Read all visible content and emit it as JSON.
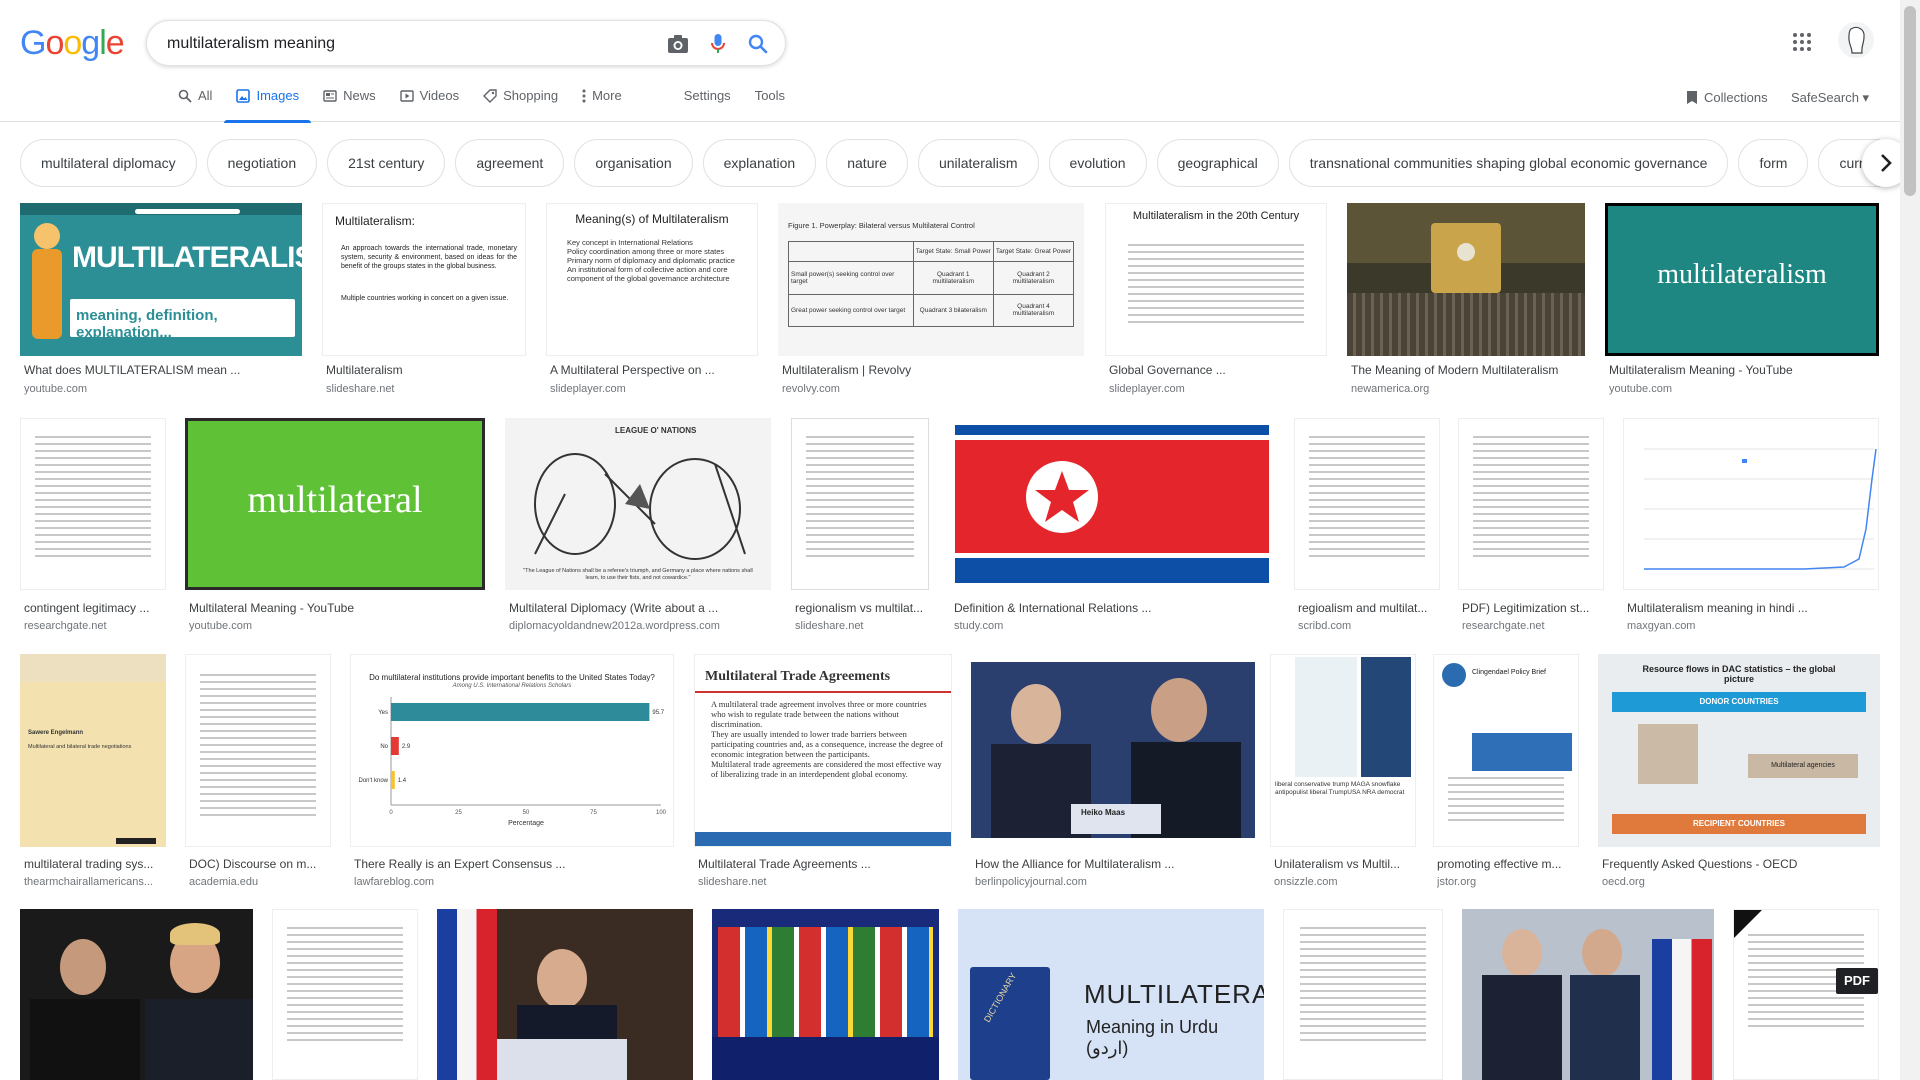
{
  "search": {
    "query": "multilateralism meaning"
  },
  "logo": {
    "letters": [
      "G",
      "o",
      "o",
      "g",
      "l",
      "e"
    ],
    "colors": [
      "#4285f4",
      "#ea4335",
      "#fbbc05",
      "#4285f4",
      "#34a853",
      "#ea4335"
    ]
  },
  "tabs": [
    {
      "label": "All",
      "icon": "search-icon"
    },
    {
      "label": "Images",
      "icon": "image-icon",
      "active": true
    },
    {
      "label": "News",
      "icon": "news-icon"
    },
    {
      "label": "Videos",
      "icon": "video-icon"
    },
    {
      "label": "Shopping",
      "icon": "tag-icon"
    },
    {
      "label": "More",
      "icon": "more-vert-icon"
    }
  ],
  "tools": {
    "settings": "Settings",
    "tools": "Tools"
  },
  "right_links": {
    "collections": "Collections",
    "safesearch": "SafeSearch ▾"
  },
  "chips": [
    "multilateral diplomacy",
    "negotiation",
    "21st century",
    "agreement",
    "organisation",
    "explanation",
    "nature",
    "unilateralism",
    "evolution",
    "geographical",
    "transnational communities shaping global economic governance",
    "form",
    "current"
  ],
  "results": [
    {
      "title": "What does MULTILATERALISM mean ...",
      "source": "youtube.com"
    },
    {
      "title": "Multilateralism",
      "source": "slideshare.net"
    },
    {
      "title": "A Multilateral Perspective on ...",
      "source": "slideplayer.com"
    },
    {
      "title": "Multilateralism | Revolvy",
      "source": "revolvy.com"
    },
    {
      "title": "Global Governance ...",
      "source": "slideplayer.com"
    },
    {
      "title": "The Meaning of Modern Multilateralism",
      "source": "newamerica.org"
    },
    {
      "title": "Multilateralism Meaning - YouTube",
      "source": "youtube.com"
    },
    {
      "title": "contingent legitimacy ...",
      "source": "researchgate.net"
    },
    {
      "title": "Multilateral Meaning - YouTube",
      "source": "youtube.com"
    },
    {
      "title": "Multilateral Diplomacy (Write about a ...",
      "source": "diplomacyoldandnew2012a.wordpress.com"
    },
    {
      "title": "regionalism vs multilat...",
      "source": "slideshare.net"
    },
    {
      "title": "Definition & International Relations ...",
      "source": "study.com"
    },
    {
      "title": "regioalism and multilat...",
      "source": "scribd.com"
    },
    {
      "title": "PDF) Legitimization st...",
      "source": "researchgate.net"
    },
    {
      "title": "Multilateralism meaning in hindi ...",
      "source": "maxgyan.com"
    },
    {
      "title": "multilateral trading sys...",
      "source": "thearmchairallamericans..."
    },
    {
      "title": "DOC) Discourse on m...",
      "source": "academia.edu"
    },
    {
      "title": "There Really is an Expert Consensus ...",
      "source": "lawfareblog.com"
    },
    {
      "title": "Multilateral Trade Agreements ...",
      "source": "slideshare.net"
    },
    {
      "title": "How the Alliance for Multilateralism ...",
      "source": "berlinpolicyjournal.com"
    },
    {
      "title": "Unilateralism vs Multil...",
      "source": "onsizzle.com"
    },
    {
      "title": "promoting effective m...",
      "source": "jstor.org"
    },
    {
      "title": "Frequently Asked Questions - OECD",
      "source": "oecd.org"
    }
  ],
  "thumb_text": {
    "t1_big": "MULTILATERALISM",
    "t1_sub": "meaning, definition, explanation...",
    "t2_title": "Multilateralism:",
    "t2_b1": "An approach towards the international trade, monetary system, security & environment, based on ideas for the benefit of the groups states in the global business.",
    "t2_b2": "Multiple countries working in concert on a given issue.",
    "t3_title": "Meaning(s) of Multilateralism",
    "t3_b1": "Key concept in International Relations",
    "t3_b2": "Policy coordination among three or more states",
    "t3_b3": "Primary norm of diplomacy and diplomatic practice",
    "t3_b4": "An institutional form of collective action and core component of the global governance architecture",
    "t4_fig": "Figure 1.  Powerplay: Bilateral versus Multilateral Control",
    "t4_rows": [
      [
        "",
        "Target State: Small Power",
        "Target State: Great Power"
      ],
      [
        "Small power(s) seeking control over target",
        "Quadrant 1 multilateralism",
        "Quadrant 2 multilateralism"
      ],
      [
        "Great power seeking control over target",
        "Quadrant 3 bilateralism",
        "Quadrant 4 multilateralism"
      ]
    ],
    "t5_title": "Multilateralism in the 20th Century",
    "t7_big": "multilateralism",
    "t9_big": "multilateral",
    "t10_a": "LEAGUE O' NATIONS",
    "t10_cap": "\"The League of Nations shall be a referee's triumph, and Germany a place where nations shall learn, to use their fists, and not cowardice.\"",
    "t16_a": "Sawere Engelmann",
    "t16_b": "Multilateral and bilateral trade negotiations",
    "t18_title": "Do multilateral institutions provide important benefits to the United States Today?",
    "t18_sub": "Among U.S. International Relations Scholars",
    "t18_xlabel": "Percentage",
    "t19_title": "Multilateral Trade Agreements",
    "t19_b1": "A multilateral trade agreement involves three or more countries who wish to regulate trade between the nations without discrimination.",
    "t19_b2": "They are usually intended to lower trade barriers between participating countries and, as a consequence, increase the degree of economic integration between the participants.",
    "t19_b3": "Multilateral trade agreements are considered the most effective way of liberalizing trade in an interdependent global economy.",
    "t20_sign": "Heiko Maas",
    "t21_text": "liberal conservative trump MAGA snowflake antipopulist liberal TrumpUSA NRA democrat",
    "t22_head": "Clingendael Policy Brief",
    "t23_title": "Resource flows in DAC statistics – the global picture",
    "t23_top": "DONOR COUNTRIES",
    "t23_mid": "Multilateral agencies",
    "t23_bot": "RECIPIENT COUNTRIES",
    "t27_a": "MULTILATERAL",
    "t27_b": "Meaning in Urdu (اردو)",
    "t27_book": "DICTIONARY",
    "t29_badge": "PDF"
  },
  "chart_data": {
    "type": "bar",
    "title": "Do multilateral institutions provide important benefits to the United States Today?",
    "categories": [
      "Yes",
      "No",
      "Don't know"
    ],
    "values": [
      95.7,
      2.9,
      1.4
    ],
    "xlabel": "Percentage",
    "xlim": [
      0,
      100
    ],
    "xticks": [
      0,
      25,
      50,
      75,
      100
    ],
    "colors": [
      "#2e8b9a",
      "#e53935",
      "#fbc02d"
    ]
  }
}
